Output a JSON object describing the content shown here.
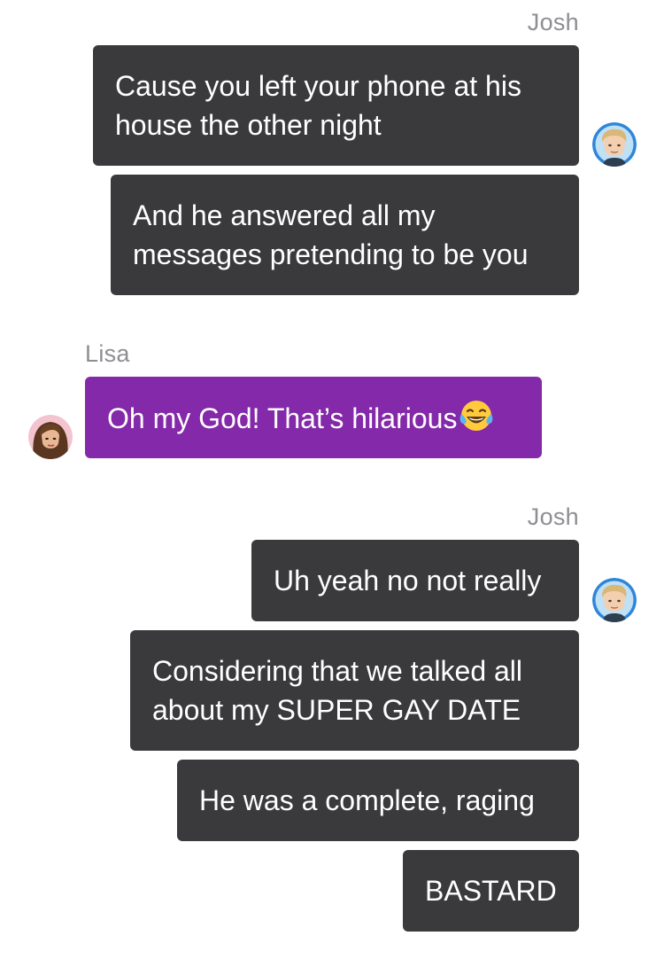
{
  "conversation": [
    {
      "sender": "Josh",
      "side": "right",
      "messages": [
        {
          "line1": "Cause you left your phone at his",
          "line2": "house the other night"
        },
        {
          "line1": "And he answered all my",
          "line2": "messages pretending to be you"
        }
      ]
    },
    {
      "sender": "Lisa",
      "side": "left",
      "messages": [
        {
          "text": "Oh my God! That’s hilarious",
          "emoji": "tears-of-joy-emoji"
        }
      ]
    },
    {
      "sender": "Josh",
      "side": "right",
      "messages": [
        {
          "text": "Uh yeah no not really"
        },
        {
          "line1": "Considering that we talked all",
          "line2": "about my SUPER GAY DATE"
        },
        {
          "text": "He was a complete, raging"
        },
        {
          "text": "BASTARD"
        }
      ]
    }
  ],
  "colors": {
    "outgoing_bubble": "#3a3a3c",
    "incoming_bubble": "#8429a9",
    "sender_name": "#8e8e93",
    "bubble_text": "#ffffff"
  },
  "avatars": {
    "josh": "josh-avatar",
    "lisa": "lisa-avatar"
  }
}
